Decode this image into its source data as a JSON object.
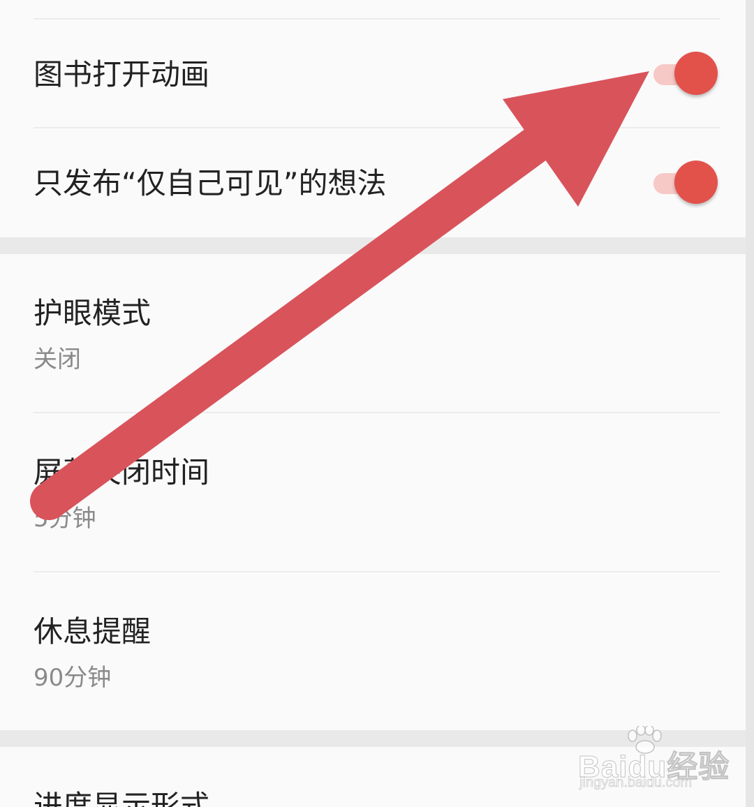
{
  "settings": {
    "book_open_animation": {
      "title": "图书打开动画",
      "enabled": true
    },
    "private_thoughts_only": {
      "title": "只发布“仅自己可见”的想法",
      "enabled": true
    },
    "eye_protection": {
      "title": "护眼模式",
      "value": "关闭"
    },
    "screen_off_time": {
      "title": "屏幕关闭时间",
      "value": "5分钟"
    },
    "rest_reminder": {
      "title": "休息提醒",
      "value": "90分钟"
    },
    "progress_display": {
      "title": "进度显示形式"
    }
  },
  "overlay": {
    "arrow_color": "#d9535b"
  },
  "watermark": {
    "logo_text": "Baidu经验",
    "url_text": "jingyan.baidu.com"
  },
  "colors": {
    "accent": "#e2524b",
    "track": "#f6c8c6",
    "background": "#fafafa",
    "separator": "#e9e9e9"
  }
}
